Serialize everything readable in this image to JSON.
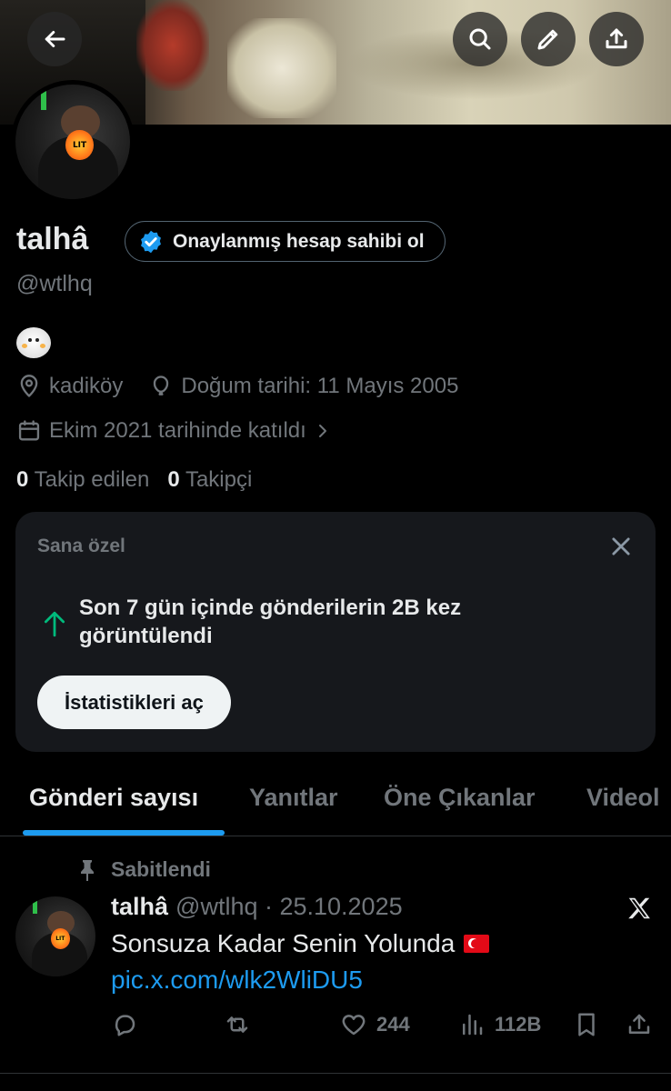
{
  "profile": {
    "name": "talhâ",
    "verify_label": "Onaylanmış hesap sahibi ol",
    "handle": "@wtlhq",
    "location": "kadiköy",
    "birthday": "Doğum tarihi: 11 Mayıs 2005",
    "joined": "Ekim 2021 tarihinde katıldı",
    "following_count": "0",
    "following_label": "Takip edilen",
    "followers_count": "0",
    "followers_label": "Takipçi"
  },
  "card": {
    "title": "Sana özel",
    "text": "Son 7 gün içinde gönderilerin 2B kez görüntülendi",
    "button": "İstatistikleri aç"
  },
  "tabs": [
    "Gönderi sayısı",
    "Yanıtlar",
    "Öne Çıkanlar",
    "Videol"
  ],
  "post": {
    "pinned_label": "Sabitlendi",
    "name": "talhâ",
    "handle_date": "@wtlhq · 25.10.2025",
    "text": "Sonsuza Kadar Senin Yolunda",
    "link": "pic.x.com/wlk2WliDU5",
    "likes": "244",
    "views": "112B"
  },
  "icons": {
    "back": "back-arrow-icon",
    "search": "search-icon",
    "edit": "pencil-icon",
    "share": "share-icon"
  },
  "colors": {
    "accent": "#1d9bf0",
    "growth": "#00ba7c",
    "muted": "#71767b"
  }
}
